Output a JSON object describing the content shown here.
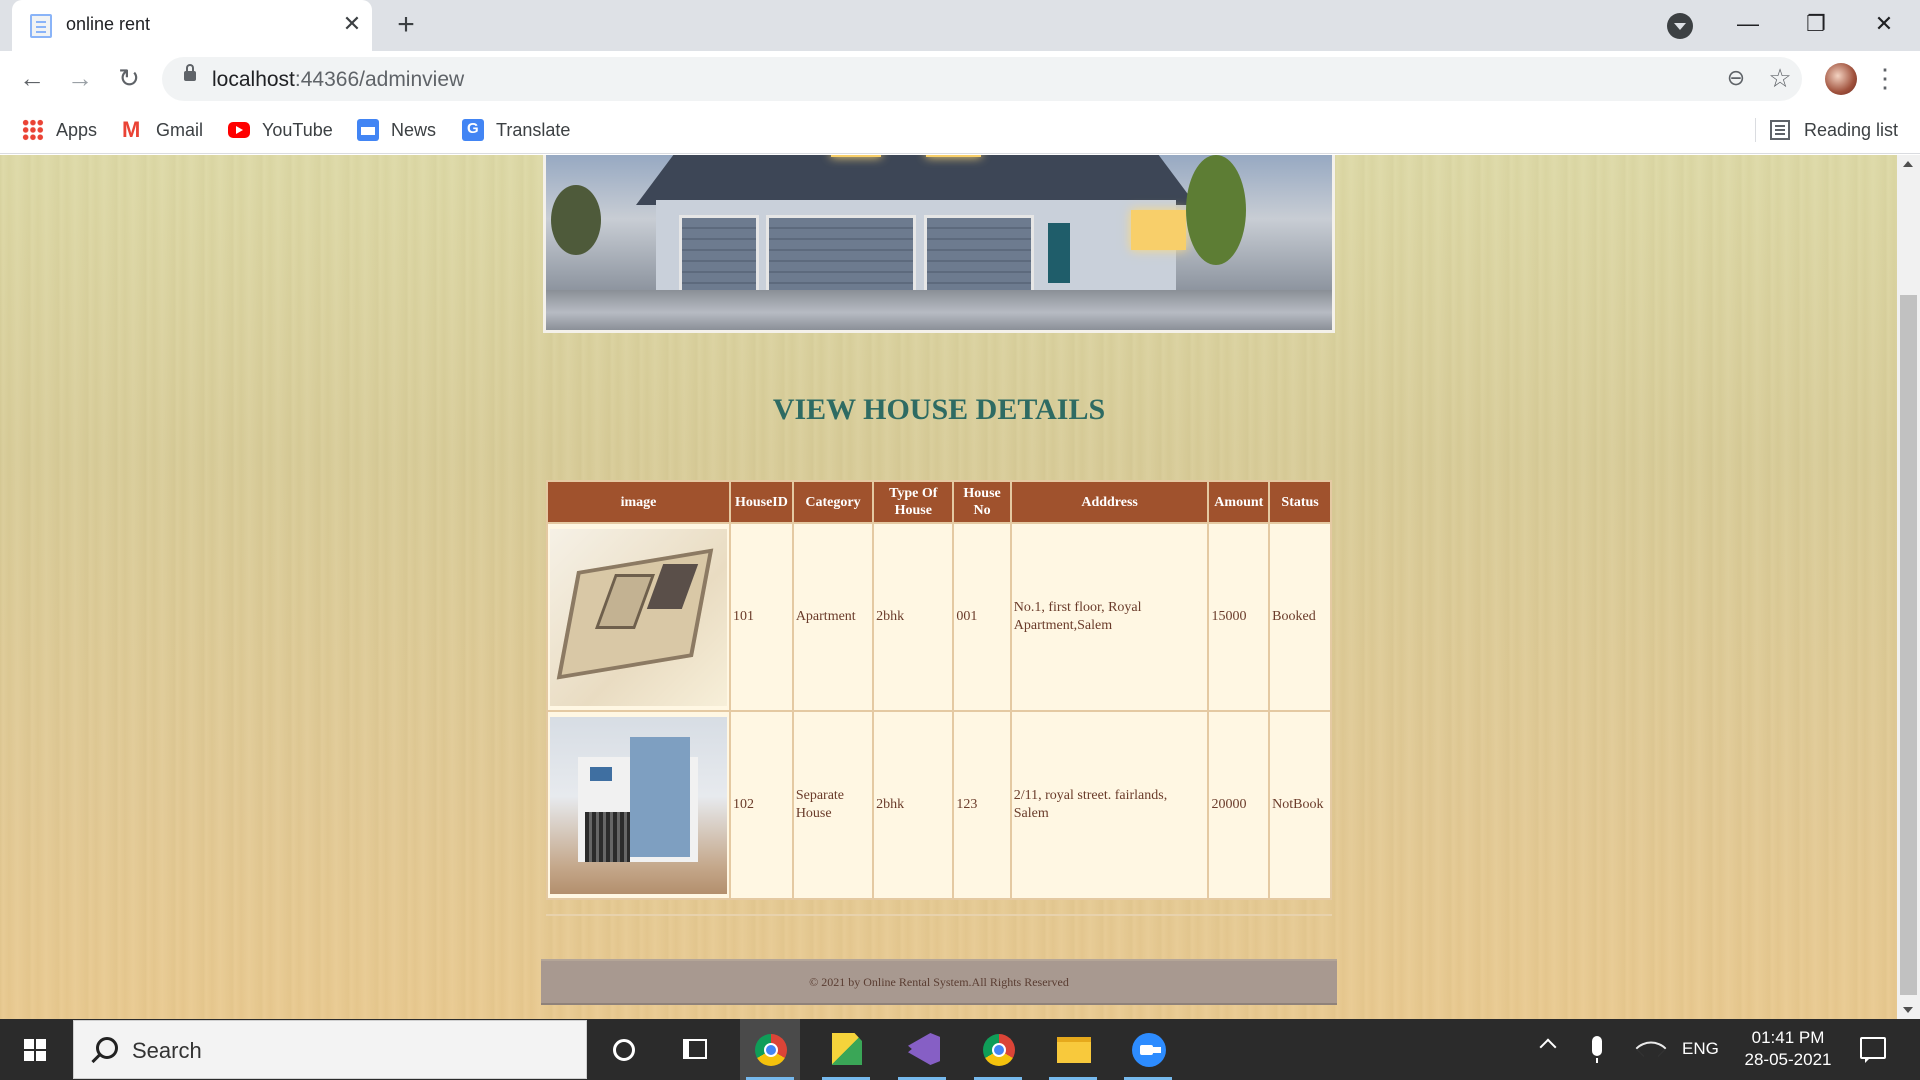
{
  "browser": {
    "tab_title": "online rent",
    "tab_close": "✕",
    "new_tab": "+",
    "url_host": "localhost",
    "url_path": ":44366/adminview",
    "nav": {
      "back": "←",
      "forward": "→",
      "reload": "↻"
    },
    "window": {
      "minimize": "—",
      "restore": "❐",
      "close": "✕"
    },
    "icons": {
      "zoom": "⊖",
      "star": "☆",
      "menu": "⋮"
    },
    "bookmarks": [
      {
        "label": "Apps",
        "icon": "apps-grid-icon"
      },
      {
        "label": "Gmail",
        "icon": "gmail-icon"
      },
      {
        "label": "YouTube",
        "icon": "youtube-icon"
      },
      {
        "label": "News",
        "icon": "news-icon"
      },
      {
        "label": "Translate",
        "icon": "translate-icon"
      }
    ],
    "reading_list": "Reading list"
  },
  "page": {
    "title": "VIEW HOUSE DETAILS",
    "table": {
      "headers": [
        "image",
        "HouseID",
        "Category",
        "Type Of House",
        "House No",
        "Adddress",
        "Amount",
        "Status"
      ],
      "rows": [
        {
          "house_id": "101",
          "category": "Apartment",
          "type": "2bhk",
          "house_no": "001",
          "address": "No.1, first floor, Royal Apartment,Salem",
          "amount": "15000",
          "status": "Booked"
        },
        {
          "house_id": "102",
          "category": "Separate House",
          "type": "2bhk",
          "house_no": "123",
          "address": "2/11, royal street. fairlands, Salem",
          "amount": "20000",
          "status": "NotBook"
        }
      ]
    },
    "footer": "© 2021 by Online Rental System.All Rights Reserved"
  },
  "taskbar": {
    "search_placeholder": "Search",
    "language": "ENG",
    "time": "01:41 PM",
    "date": "28-05-2021"
  },
  "colors": {
    "title": "#2e6b63",
    "table_header": "#a0522d",
    "table_cell": "#fff7e3",
    "footer_bg": "#a89990"
  }
}
